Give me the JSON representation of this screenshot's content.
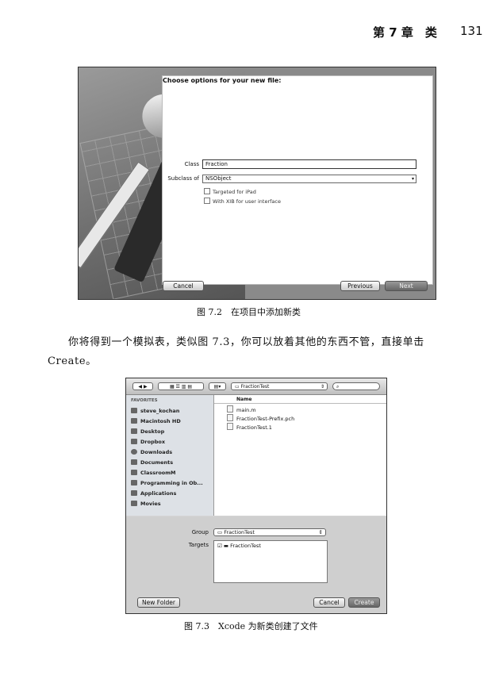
{
  "header": {
    "chapter": "第 7 章　类",
    "page_number": "131"
  },
  "figure1": {
    "title": "Choose options for your new file:",
    "class_label": "Class",
    "class_value": "Fraction",
    "subclass_label": "Subclass of",
    "subclass_value": "NSObject",
    "option_ipad": "Targeted for iPad",
    "option_xib": "With XIB for user interface",
    "cancel": "Cancel",
    "previous": "Previous",
    "next": "Next",
    "caption": "图 7.2　在项目中添加新类"
  },
  "body_text": {
    "line1": "你将得到一个模拟表，类似图 7.3，你可以放着其他的东西不管，直接单击",
    "line2": "Create。"
  },
  "figure2": {
    "path_folder": "FractionTest",
    "search_placeholder": "",
    "favorites_heading": "FAVORITES",
    "sidebar_items": [
      "steve_kochan",
      "Macintosh HD",
      "Desktop",
      "Dropbox",
      "Downloads",
      "Documents",
      "ClassroomM",
      "Programming in Ob...",
      "Applications",
      "Movies"
    ],
    "column_name": "Name",
    "files": [
      "main.m",
      "FractionTest-Prefix.pch",
      "FractionTest.1"
    ],
    "group_label": "Group",
    "group_value": "FractionTest",
    "targets_label": "Targets",
    "target_item": "FractionTest",
    "new_folder": "New Folder",
    "cancel": "Cancel",
    "create": "Create",
    "caption": "图 7.3　Xcode 为新类创建了文件"
  }
}
